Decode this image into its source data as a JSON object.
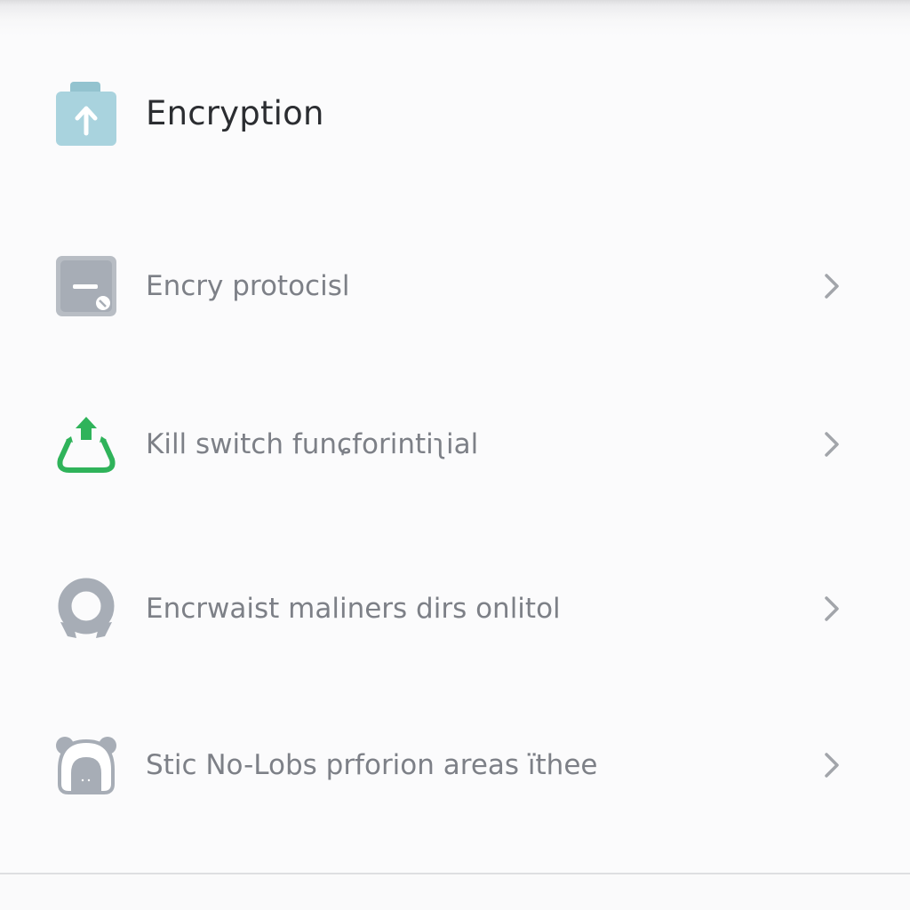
{
  "header": {
    "title": "Encryption",
    "icon": "upload-lock-icon",
    "icon_color": "#a9d3de"
  },
  "settings": {
    "items": [
      {
        "label": "Encry protocisl",
        "icon": "protocol-box-icon",
        "icon_color": "#a7adb6",
        "chevron": "chevron-right-icon"
      },
      {
        "label": "Kill switch funɕforintiʅial",
        "icon": "kill-switch-icon",
        "icon_color": "#2fb35a",
        "chevron": "chevron-right-icon"
      },
      {
        "label": "Encrwaist maliners dirs onlitol",
        "icon": "ring-shield-icon",
        "icon_color": "#a7adb6",
        "chevron": "chevron-right-icon"
      },
      {
        "label": "Stic No-Lobs prforion areas їthee",
        "icon": "bear-icon",
        "icon_color": "#a7adb6",
        "chevron": "chevron-right-icon"
      }
    ]
  }
}
